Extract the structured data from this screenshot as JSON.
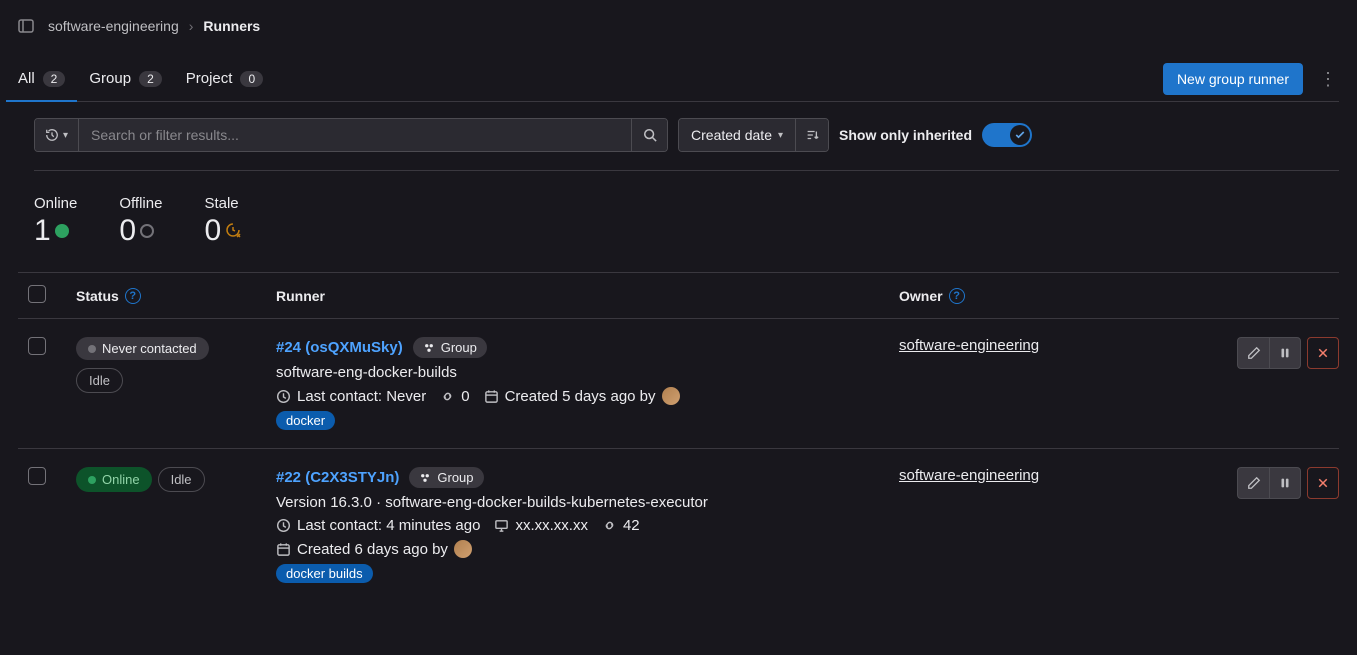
{
  "breadcrumb": {
    "parent": "software-engineering",
    "current": "Runners"
  },
  "tabs": {
    "all": {
      "label": "All",
      "count": "2"
    },
    "group": {
      "label": "Group",
      "count": "2"
    },
    "project": {
      "label": "Project",
      "count": "0"
    }
  },
  "primary_button": "New group runner",
  "search": {
    "placeholder": "Search or filter results..."
  },
  "sort": {
    "label": "Created date"
  },
  "toggle": {
    "label": "Show only inherited"
  },
  "stats": {
    "online": {
      "label": "Online",
      "value": "1"
    },
    "offline": {
      "label": "Offline",
      "value": "0"
    },
    "stale": {
      "label": "Stale",
      "value": "0"
    }
  },
  "columns": {
    "status": "Status",
    "runner": "Runner",
    "owner": "Owner"
  },
  "rows": [
    {
      "status_primary": "Never contacted",
      "status_secondary": "Idle",
      "online": false,
      "id_label": "#24 (osQXMuSky)",
      "scope": "Group",
      "description": "software-eng-docker-builds",
      "last_contact": "Last contact: Never",
      "jobs": "0",
      "ip": "",
      "created": "Created 5 days ago by",
      "tags": [
        "docker"
      ],
      "owner": "software-engineering"
    },
    {
      "status_primary": "Online",
      "status_secondary": "Idle",
      "online": true,
      "id_label": "#22 (C2X3STYJn)",
      "scope": "Group",
      "description": "Version 16.3.0 · software-eng-docker-builds-kubernetes-executor",
      "last_contact": "Last contact: 4 minutes ago",
      "jobs": "42",
      "ip": "xx.xx.xx.xx",
      "created": "Created 6 days ago by",
      "tags": [
        "docker builds"
      ],
      "owner": "software-engineering"
    }
  ]
}
